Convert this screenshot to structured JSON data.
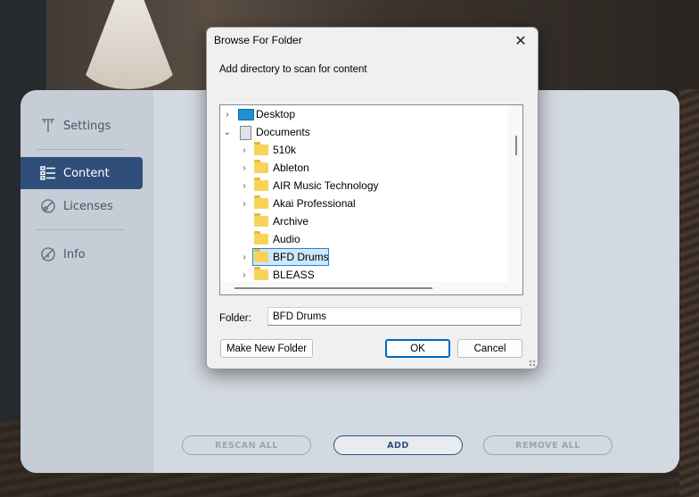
{
  "app": {
    "sidebar": {
      "items": [
        {
          "label": "Settings",
          "icon": "pin-icon"
        },
        {
          "label": "Content",
          "icon": "list-icon",
          "active": true
        },
        {
          "label": "Licenses",
          "icon": "license-icon"
        },
        {
          "label": "Info",
          "icon": "info-icon"
        }
      ]
    },
    "buttons": {
      "rescan_all": "RESCAN ALL",
      "add": "ADD",
      "remove_all": "REMOVE ALL"
    }
  },
  "dialog": {
    "title": "Browse For Folder",
    "close_glyph": "✕",
    "description": "Add directory to scan for content",
    "tree": [
      {
        "label": "Desktop",
        "level": 0,
        "icon": "desktop-icon",
        "expander": "collapsed"
      },
      {
        "label": "Documents",
        "level": 0,
        "icon": "documents-icon",
        "expander": "expanded"
      },
      {
        "label": "510k",
        "level": 1,
        "icon": "folder-icon",
        "expander": "collapsed"
      },
      {
        "label": "Ableton",
        "level": 1,
        "icon": "folder-icon",
        "expander": "collapsed"
      },
      {
        "label": "AIR Music Technology",
        "level": 1,
        "icon": "folder-icon",
        "expander": "collapsed"
      },
      {
        "label": "Akai Professional",
        "level": 1,
        "icon": "folder-icon",
        "expander": "collapsed"
      },
      {
        "label": "Archive",
        "level": 1,
        "icon": "folder-icon",
        "expander": "none"
      },
      {
        "label": "Audio",
        "level": 1,
        "icon": "folder-icon",
        "expander": "none"
      },
      {
        "label": "BFD Drums",
        "level": 1,
        "icon": "folder-icon",
        "expander": "collapsed",
        "selected": true
      },
      {
        "label": "BLEASS",
        "level": 1,
        "icon": "folder-icon",
        "expander": "collapsed"
      }
    ],
    "folder_label": "Folder:",
    "folder_value": "BFD Drums",
    "make_new_folder": "Make New Folder",
    "ok": "OK",
    "cancel": "Cancel"
  }
}
